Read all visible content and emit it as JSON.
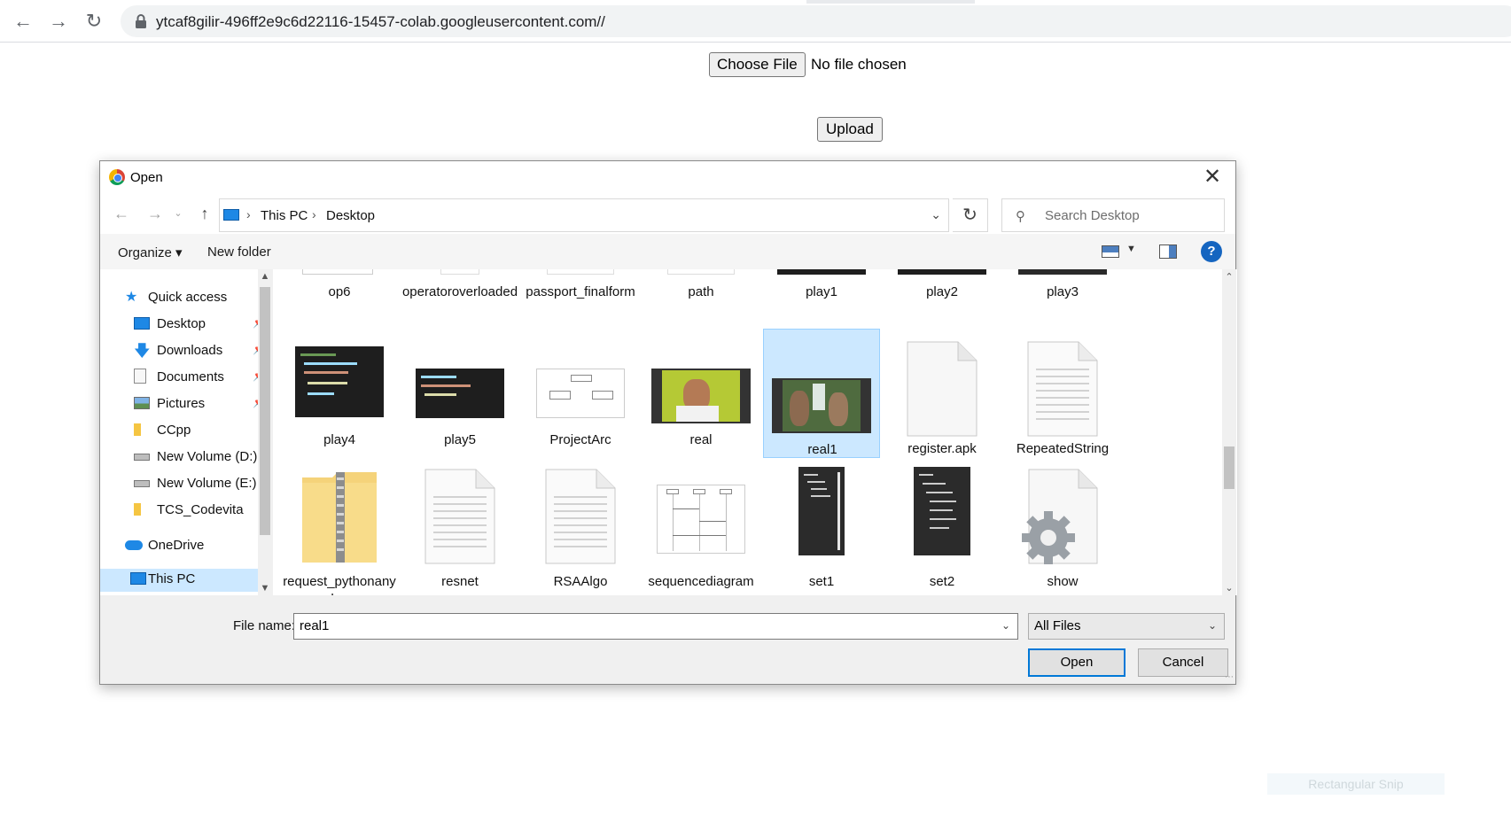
{
  "browser": {
    "url": "ytcaf8gilir-496ff2e9c6d22116-15457-colab.googleusercontent.com//",
    "back_icon": "←",
    "forward_icon": "→",
    "reload_icon": "↻"
  },
  "page": {
    "choose_file_label": "Choose File",
    "no_file_text": "No file chosen",
    "upload_label": "Upload"
  },
  "dialog": {
    "title": "Open",
    "close_icon": "✕",
    "breadcrumbs": [
      "This PC",
      "Desktop"
    ],
    "search_placeholder": "Search Desktop",
    "toolbar": {
      "organize": "Organize ▾",
      "new_folder": "New folder",
      "help": "?"
    },
    "nav_items": [
      {
        "label": "Quick access",
        "icon": "star-icon",
        "pinned": false
      },
      {
        "label": "Desktop",
        "icon": "desktop-icon",
        "pinned": true
      },
      {
        "label": "Downloads",
        "icon": "download-icon",
        "pinned": true
      },
      {
        "label": "Documents",
        "icon": "documents-icon",
        "pinned": true
      },
      {
        "label": "Pictures",
        "icon": "pictures-icon",
        "pinned": true
      },
      {
        "label": "CCpp",
        "icon": "folder-icon",
        "pinned": false
      },
      {
        "label": "New Volume (D:)",
        "icon": "drive-icon",
        "pinned": false
      },
      {
        "label": "New Volume (E:)",
        "icon": "drive-icon",
        "pinned": false
      },
      {
        "label": "TCS_Codevita",
        "icon": "folder-icon",
        "pinned": false
      },
      {
        "label": "OneDrive",
        "icon": "cloud-icon",
        "pinned": false
      },
      {
        "label": "This PC",
        "icon": "pc-icon",
        "pinned": false
      }
    ],
    "files_row1": [
      "op6",
      "operatoroverloaded",
      "passport_finalform",
      "path",
      "play1",
      "play2",
      "play3"
    ],
    "files_row2": [
      "play4",
      "play5",
      "ProjectArc",
      "real",
      "real1",
      "register.apk",
      "RepeatedString"
    ],
    "files_row3": [
      "request_pythonanywhere",
      "resnet",
      "RSAAlgo",
      "sequencediagram",
      "set1",
      "set2",
      "show"
    ],
    "selected_file": "real1",
    "file_name_label": "File name:",
    "file_name_value": "real1",
    "file_type": "All Files",
    "open_label": "Open",
    "cancel_label": "Cancel"
  },
  "overlay": {
    "snip_text": "Rectangular Snip"
  },
  "colors": {
    "selection": "#cce8ff",
    "accent": "#0078d7"
  }
}
